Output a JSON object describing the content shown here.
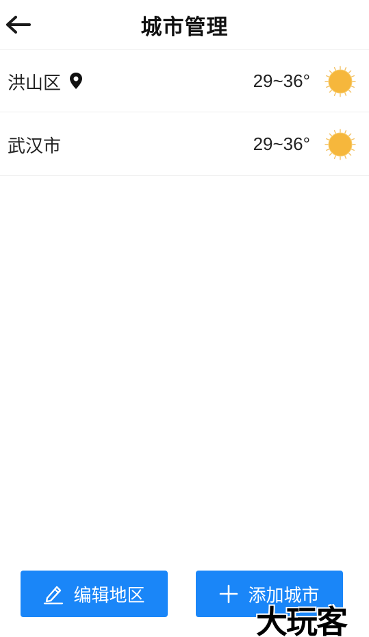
{
  "header": {
    "title": "城市管理",
    "back_icon": "arrow-left-icon"
  },
  "cities": [
    {
      "name": "洪山区",
      "temp": "29~36°",
      "weather_icon": "sun-icon",
      "located": true
    },
    {
      "name": "武汉市",
      "temp": "29~36°",
      "weather_icon": "sun-icon",
      "located": false
    }
  ],
  "actions": {
    "edit_label": "编辑地区",
    "edit_icon": "pencil-icon",
    "add_label": "添加城市",
    "add_icon": "plus-icon"
  },
  "watermark": "大玩客",
  "colors": {
    "accent": "#1a86f8",
    "sun_core": "#f6b73c",
    "sun_ray": "#f3c267"
  }
}
